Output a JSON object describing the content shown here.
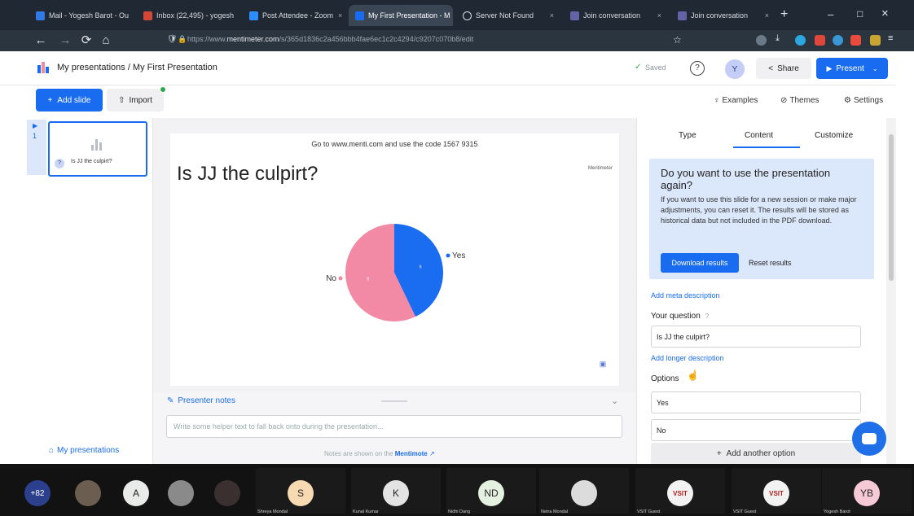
{
  "browser": {
    "tabs": [
      {
        "label": "Mail - Yogesh Barot - Ou",
        "color": "#2f7ae5"
      },
      {
        "label": "Inbox (22,495) - yogesh",
        "color": "#d44638"
      },
      {
        "label": "Post Attendee - Zoom",
        "color": "#2d8cff"
      },
      {
        "label": "My First Presentation - M",
        "color": "#196cf0"
      },
      {
        "label": "Server Not Found",
        "color": "#9aa6b2"
      },
      {
        "label": "Join conversation",
        "color": "#6264a7"
      },
      {
        "label": "Join conversation",
        "color": "#6264a7"
      }
    ],
    "new_tab": "+",
    "window_min": "–",
    "window_max": "□",
    "window_close": "×",
    "url_prefix": "https://www.",
    "url_domain": "mentimeter.com",
    "url_rest": "/s/365d1836c2a456bbb4fae6ec1c2c4294/c9207c070b8/edit"
  },
  "header": {
    "breadcrumb": "My presentations / My First Presentation",
    "saved": "Saved",
    "avatar_letter": "Y",
    "share": "Share",
    "present": "Present"
  },
  "toolbar": {
    "add_slide": "Add slide",
    "import": "Import",
    "examples": "Examples",
    "themes": "Themes",
    "settings": "Settings"
  },
  "slide_list": {
    "number": "1",
    "title": "Is JJ the culpirt?",
    "footer": "My presentations"
  },
  "slide": {
    "instruction": "Go to www.menti.com and use the code 1567 9315",
    "title": "Is JJ the culpirt?",
    "brand": "Mentimeter"
  },
  "chart_data": {
    "type": "pie",
    "labels": [
      "Yes",
      "No"
    ],
    "values": [
      6,
      8
    ],
    "slice_labels": [
      "6",
      "8"
    ],
    "colors": [
      "#1a6cf0",
      "#f28aa6"
    ]
  },
  "notes": {
    "title": "Presenter notes",
    "placeholder": "Write some helper text to fall back onto during the presentation...",
    "footer_text": "Notes are shown on the",
    "footer_link": "Mentimote"
  },
  "panel": {
    "tabs": [
      "Type",
      "Content",
      "Customize"
    ],
    "info_title": "Do you want to use the presentation again?",
    "info_text": "If you want to use this slide for a new session or make major adjustments, you can reset it. The results will be stored as historical data but not included in the PDF download.",
    "download": "Download results",
    "reset": "Reset results",
    "add_meta": "Add meta description",
    "question_label": "Your question",
    "question_value": "Is JJ the culpirt?",
    "add_longer": "Add longer description",
    "options_label": "Options",
    "options": [
      "Yes",
      "No"
    ],
    "add_option": "Add another option"
  },
  "zoom": {
    "more_count": "+82",
    "participants": [
      {
        "initials": "",
        "name": "",
        "bg": "#6b5d4f"
      },
      {
        "initials": "A",
        "name": "",
        "bg": "#e9ebe9"
      },
      {
        "initials": "",
        "name": "",
        "bg": "#8a8a8a"
      },
      {
        "initials": "",
        "name": "",
        "bg": "#3a3030"
      },
      {
        "initials": "S",
        "name": "Shreya Mondal",
        "bg": "#f7d9b2"
      },
      {
        "initials": "K",
        "name": "Kunal Kumar",
        "bg": "#e3e3e3"
      },
      {
        "initials": "ND",
        "name": "Nidhi Dang",
        "bg": "#e4f0e0"
      },
      {
        "initials": "",
        "name": "Netra Mondal",
        "bg": "#dcdcdc"
      },
      {
        "initials": "VSIT",
        "name": "VSIT Guest",
        "bg": "#f2f2f2"
      },
      {
        "initials": "VSIT",
        "name": "VSIT Guest",
        "bg": "#f2f2f2"
      },
      {
        "initials": "YB",
        "name": "Yogesh Barot",
        "bg": "#f6c9d6"
      }
    ]
  }
}
